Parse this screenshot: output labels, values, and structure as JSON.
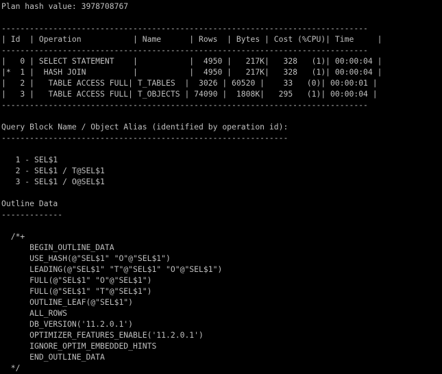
{
  "terminal": {
    "lines": [
      "Plan hash value: 3978708767",
      "",
      "------------------------------------------------------------------------------",
      "| Id  | Operation           | Name      | Rows  | Bytes | Cost (%CPU)| Time     |",
      "------------------------------------------------------------------------------",
      "|   0 | SELECT STATEMENT    |           |  4950 |   217K|   328   (1)| 00:00:04 |",
      "|*  1 |  HASH JOIN          |           |  4950 |   217K|   328   (1)| 00:00:04 |",
      "|   2 |   TABLE ACCESS FULL| T_TABLES  |  3026 | 60520 |    33   (0)| 00:00:01 |",
      "|   3 |   TABLE ACCESS FULL| T_OBJECTS | 74090 |  1808K|   295   (1)| 00:00:04 |",
      "------------------------------------------------------------------------------",
      "",
      "Query Block Name / Object Alias (identified by operation id):",
      "-------------------------------------------------------------",
      "",
      "   1 - SEL$1",
      "   2 - SEL$1 / T@SEL$1",
      "   3 - SEL$1 / O@SEL$1",
      "",
      "Outline Data",
      "-------------",
      "",
      "  /*+",
      "      BEGIN_OUTLINE_DATA",
      "      USE_HASH(@\"SEL$1\" \"O\"@\"SEL$1\")",
      "      LEADING(@\"SEL$1\" \"T\"@\"SEL$1\" \"O\"@\"SEL$1\")",
      "      FULL(@\"SEL$1\" \"O\"@\"SEL$1\")",
      "      FULL(@\"SEL$1\" \"T\"@\"SEL$1\")",
      "      OUTLINE_LEAF(@\"SEL$1\")",
      "      ALL_ROWS",
      "      DB_VERSION('11.2.0.1')",
      "      OPTIMIZER_FEATURES_ENABLE('11.2.0.1')",
      "      IGNORE_OPTIM_EMBEDDED_HINTS",
      "      END_OUTLINE_DATA",
      "  */"
    ]
  }
}
